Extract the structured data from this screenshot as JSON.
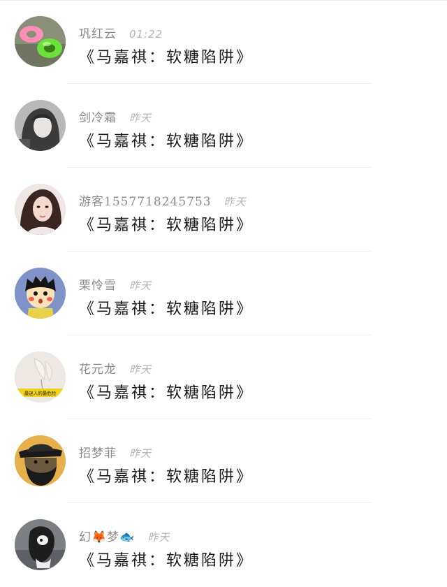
{
  "messages": [
    {
      "name": "巩红云",
      "time": "01:22",
      "text": "《马嘉祺：软糖陷阱》",
      "avatar": "avatar-pool-float"
    },
    {
      "name": "剑冷霜",
      "time": "昨天",
      "text": "《马嘉祺：软糖陷阱》",
      "avatar": "avatar-girl-bw"
    },
    {
      "name": "游客1557718245753",
      "time": "昨天",
      "text": "《马嘉祺：软糖陷阱》",
      "avatar": "avatar-girl-photo"
    },
    {
      "name": "栗怜雪",
      "time": "昨天",
      "text": "《马嘉祺：软糖陷阱》",
      "avatar": "avatar-cartoon-boy"
    },
    {
      "name": "花元龙",
      "time": "昨天",
      "text": "《马嘉祺：软糖陷阱》",
      "avatar": "avatar-flower-text",
      "avatar_caption": "最迷人的最危险"
    },
    {
      "name": "招梦菲",
      "time": "昨天",
      "text": "《马嘉祺：软糖陷阱》",
      "avatar": "avatar-cartoon-man"
    },
    {
      "name": "幻🦊梦🐟",
      "time": "昨天",
      "text": "《马嘉祺：软糖陷阱》",
      "avatar": "avatar-dog-photo"
    }
  ]
}
